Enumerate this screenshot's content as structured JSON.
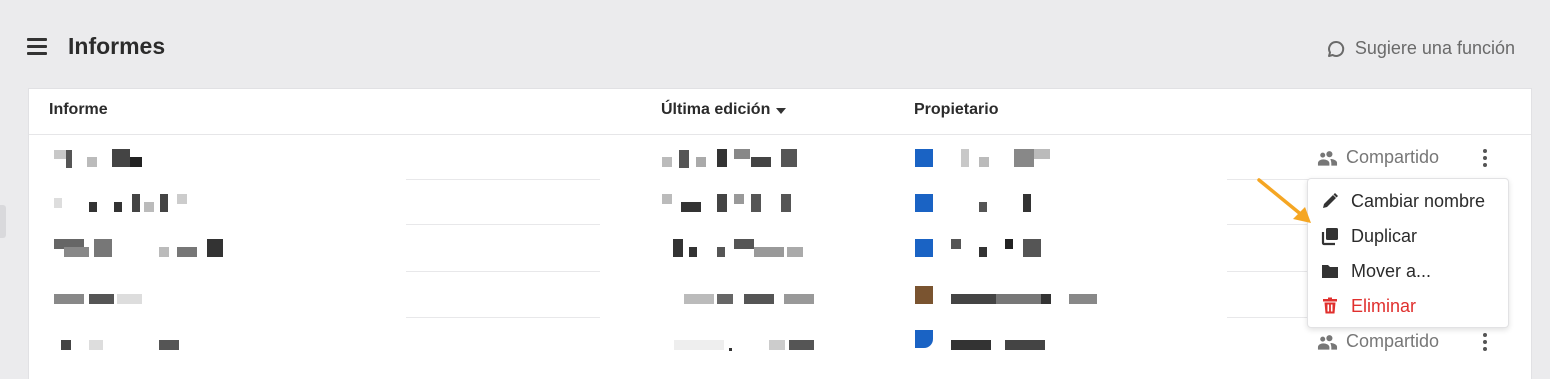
{
  "header": {
    "title": "Informes",
    "suggest_label": "Sugiere una función"
  },
  "table": {
    "columns": {
      "report": "Informe",
      "last_edit": "Última edición",
      "owner": "Propietario"
    },
    "rows": [
      {
        "shared_label": "Compartido"
      },
      {
        "shared_label": ""
      },
      {
        "shared_label": ""
      },
      {
        "shared_label": ""
      },
      {
        "shared_label": "Compartido"
      }
    ]
  },
  "row_menu": {
    "items": [
      {
        "label": "Cambiar nombre",
        "icon": "pencil-icon"
      },
      {
        "label": "Duplicar",
        "icon": "duplicate-icon"
      },
      {
        "label": "Mover a...",
        "icon": "folder-icon"
      },
      {
        "label": "Eliminar",
        "icon": "trash-icon"
      }
    ]
  },
  "colors": {
    "background": "#ebebed",
    "danger": "#e0302e",
    "annotation_arrow": "#f5a623",
    "owner_avatar_blue": "#1a63c4"
  }
}
